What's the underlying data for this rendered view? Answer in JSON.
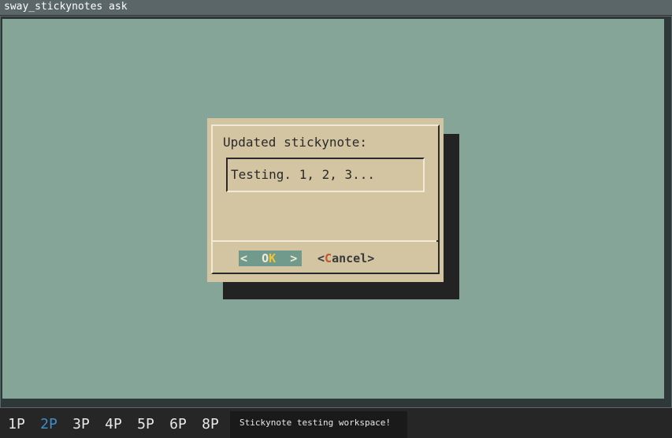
{
  "window": {
    "title": "sway_stickynotes ask"
  },
  "dialog": {
    "prompt": "Updated stickynote:",
    "input_value": "Testing. 1, 2, 3...",
    "ok_left": "<  ",
    "ok_o": "O",
    "ok_k": "K",
    "ok_right": "  >",
    "cancel_open": "<",
    "cancel_hot": "C",
    "cancel_rest": "ancel>"
  },
  "bar": {
    "workspaces": [
      {
        "label": "1P",
        "active": false
      },
      {
        "label": "2P",
        "active": true
      },
      {
        "label": "3P",
        "active": false
      },
      {
        "label": "4P",
        "active": false
      },
      {
        "label": "5P",
        "active": false
      },
      {
        "label": "6P",
        "active": false
      },
      {
        "label": "8P",
        "active": false
      }
    ],
    "status_text": "Stickynote testing workspace!"
  },
  "colors": {
    "background": "#84a597",
    "dialog": "#d3c5a2",
    "active_workspace": "#3f8fc9",
    "ok_button": "#6f9a8c",
    "hotkey_ok": "#f4c430",
    "hotkey_cancel": "#c4542b"
  }
}
